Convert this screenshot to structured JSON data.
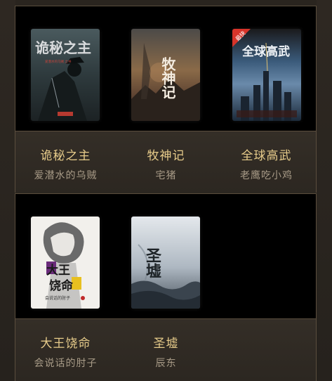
{
  "shelves": [
    {
      "books": [
        {
          "title": "诡秘之主",
          "author": "爱潜水的乌贼",
          "cover_title": "诡秘之主",
          "cover_subtitle": "爱潜水的乌贼 之书",
          "cover_color": "#3b4a4f"
        },
        {
          "title": "牧神记",
          "author": "宅猪",
          "cover_title": "牧神记",
          "cover_color": "#6b5a4a"
        },
        {
          "title": "全球高武",
          "author": "老鹰吃小鸡",
          "cover_title": "全球高武",
          "cover_badge": "最快",
          "cover_color": "#2a4a6a"
        }
      ]
    },
    {
      "books": [
        {
          "title": "大王饶命",
          "author": "会说话的肘子",
          "cover_title_top": "大王",
          "cover_title_bottom": "饶命",
          "cover_subtitle": "会说话的肘子",
          "cover_color": "#f0eee8"
        },
        {
          "title": "圣墟",
          "author": "辰东",
          "cover_title": "圣墟",
          "cover_color": "#cfd6dc"
        }
      ]
    }
  ]
}
